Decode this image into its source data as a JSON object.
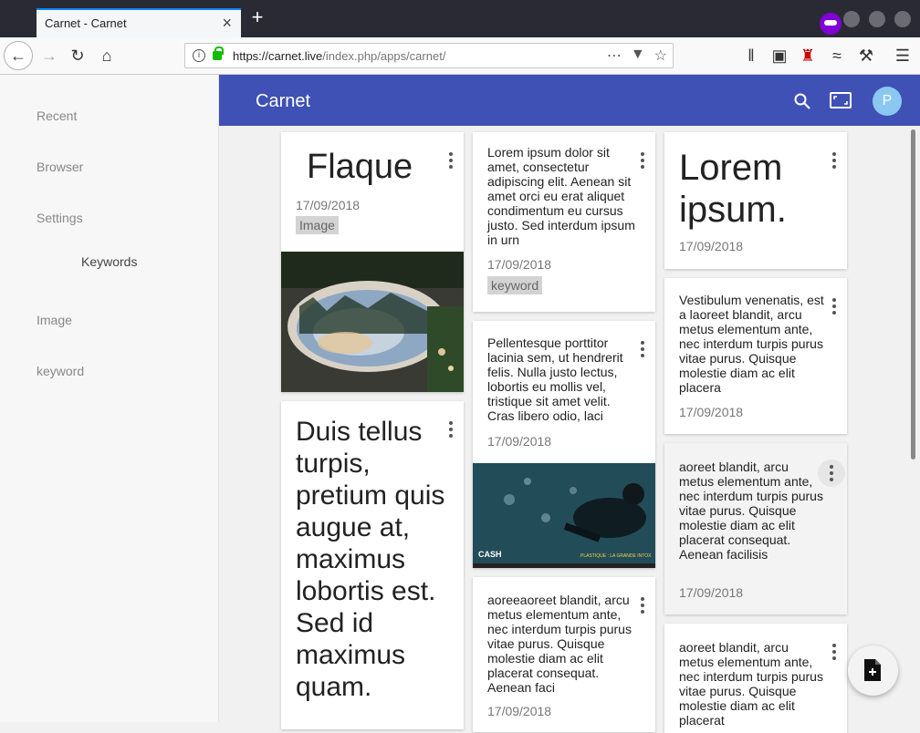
{
  "browser": {
    "tab_title": "Carnet - Carnet",
    "url_host": "https://carnet.live",
    "url_path": "/index.php/apps/carnet/",
    "close_glyph": "×",
    "newtab_glyph": "+"
  },
  "sidebar": {
    "items": [
      {
        "label": "Recent"
      },
      {
        "label": "Browser"
      },
      {
        "label": "Settings"
      },
      {
        "label": "Keywords"
      },
      {
        "label": "Image"
      },
      {
        "label": "keyword"
      }
    ]
  },
  "header": {
    "title": "Carnet",
    "avatar_letter": "P",
    "accent": "#3f51b5"
  },
  "notes": {
    "flaque": {
      "title": "Flaque",
      "date": "17/09/2018",
      "keyword": "Image"
    },
    "duis": {
      "text": "Duis tellus turpis, pretium quis augue at, maximus lobortis est. Sed id maximus quam."
    },
    "lorem1": {
      "text": "Lorem ipsum dolor sit amet, consectetur adipiscing elit. Aenean sit amet orci eu erat aliquet condimentum eu cursus justo. Sed interdum ipsum in urn",
      "date": "17/09/2018",
      "keyword": "keyword"
    },
    "pellentesque": {
      "text": "Pellentesque porttitor lacinia sem, ut hendrerit felis. Nulla justo lectus, lobortis eu mollis vel, tristique sit amet velit. Cras libero odio, laci",
      "date": "17/09/2018"
    },
    "aoreeaoreet": {
      "text": "aoreeaoreet blandit, arcu metus elementum ante, nec interdum turpis purus vitae purus. Quisque molestie diam ac elit placerat consequat. Aenean faci",
      "date": "17/09/2018"
    },
    "loremtitle": {
      "title": "Lorem ipsum.",
      "date": "17/09/2018"
    },
    "vestibulum": {
      "text": "Vestibulum venenatis, est a laoreet blandit, arcu metus elementum ante, nec interdum turpis purus vitae purus. Quisque molestie diam ac elit placera",
      "date": "17/09/2018"
    },
    "aoreet1": {
      "text": "aoreet blandit, arcu metus elementum ante, nec interdum turpis purus vitae purus. Quisque molestie diam ac elit placerat consequat. Aenean facilisis",
      "date": "17/09/2018"
    },
    "aoreet2": {
      "text": "aoreet blandit, arcu metus elementum ante, nec interdum turpis purus vitae purus. Quisque molestie diam ac elit placerat"
    }
  },
  "video": {
    "label": "CASH",
    "caption": "PLASTIQUE : LA GRANDE INTOX"
  }
}
